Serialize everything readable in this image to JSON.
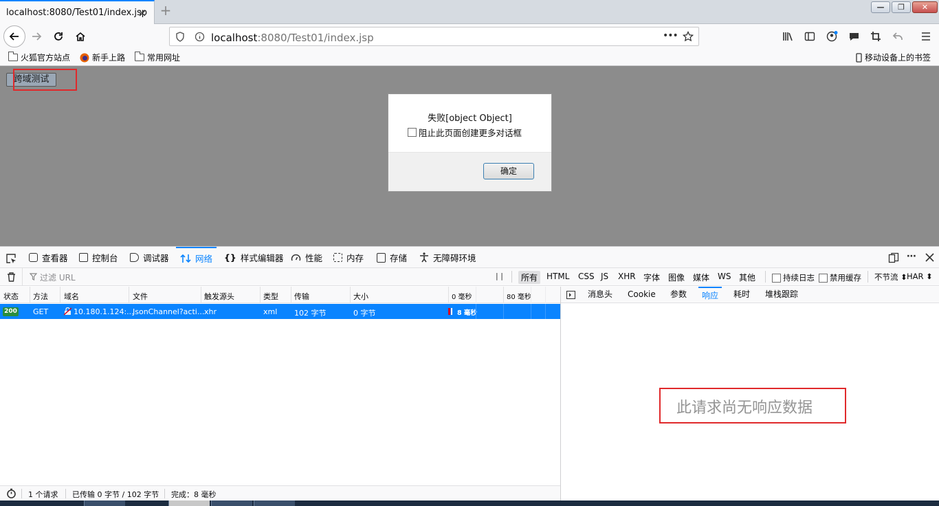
{
  "tab": {
    "title": "localhost:8080/Test01/index.jsp",
    "close": "×",
    "new_tab": "+"
  },
  "window_controls": {
    "minimize": "—",
    "restore": "❐",
    "close": "✕"
  },
  "navbar": {
    "url_host": "localhost",
    "url_rest": ":8080/Test01/index.jsp",
    "page_actions": "•••"
  },
  "bookmarks": {
    "items": [
      "火狐官方站点",
      "新手上路",
      "常用网址"
    ],
    "mobile": "移动设备上的书签"
  },
  "page": {
    "button_label": "跨域测试",
    "dialog": {
      "message": "失败[object Object]",
      "checkbox_label": "阻止此页面创建更多对话框",
      "ok_label": "确定"
    }
  },
  "devtools": {
    "tabs": [
      "查看器",
      "控制台",
      "调试器",
      "网络",
      "样式编辑器",
      "性能",
      "内存",
      "存储",
      "无障碍环境"
    ],
    "active_tab": "网络",
    "filter_placeholder": "过滤 URL",
    "pause_label": "| |",
    "types": [
      "所有",
      "HTML",
      "CSS",
      "JS",
      "XHR",
      "字体",
      "图像",
      "媒体",
      "WS",
      "其他"
    ],
    "active_type": "所有",
    "persist_logs": "持续日志",
    "disable_cache": "禁用缓存",
    "throttle": "不节流 ⬍",
    "har": "HAR ⬍",
    "columns": [
      "状态",
      "方法",
      "域名",
      "文件",
      "触发源头",
      "类型",
      "传输",
      "大小"
    ],
    "waterfall_ticks": [
      "0 毫秒",
      "80 毫秒"
    ],
    "request": {
      "status": "200",
      "method": "GET",
      "domain": "10.180.1.124:...",
      "file": "JsonChannel?acti...",
      "cause": "xhr",
      "type": "xml",
      "transferred": "102 字节",
      "size": "0 字节",
      "timing": "8 毫秒"
    },
    "details_tabs": [
      "消息头",
      "Cookie",
      "参数",
      "响应",
      "耗时",
      "堆栈跟踪"
    ],
    "details_active": "响应",
    "no_response": "此请求尚无响应数据",
    "status_bar": {
      "requests": "1 个请求",
      "transferred": "已传输 0 字节 / 102 字节",
      "finish": "完成：8 毫秒"
    }
  },
  "colors": {
    "accent": "#0a84ff",
    "highlight_box": "#e0292b",
    "page_bg": "#8c8c8c",
    "status_ok": "#2a8d3d"
  }
}
